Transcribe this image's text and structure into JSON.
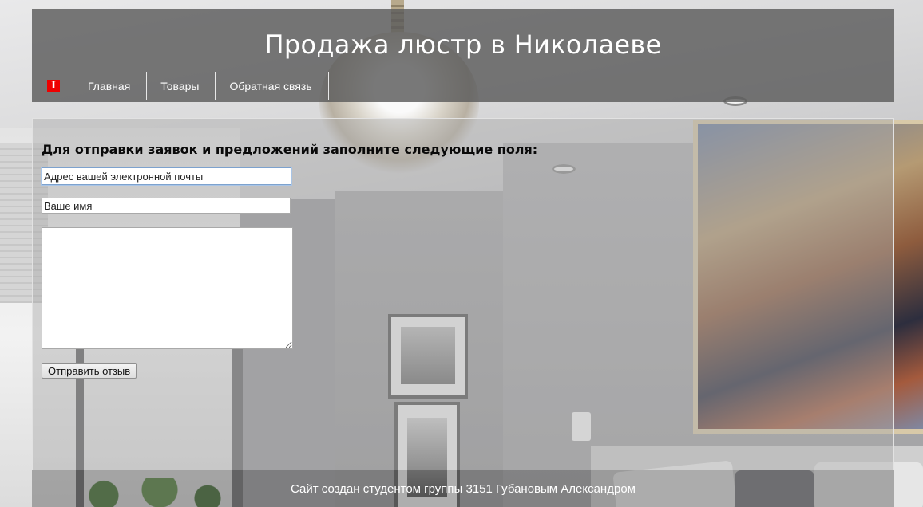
{
  "header": {
    "title": "Продажа люстр в Николаеве",
    "logo_glyph": "I",
    "nav": [
      {
        "label": "Главная"
      },
      {
        "label": "Товары"
      },
      {
        "label": "Обратная связь"
      }
    ]
  },
  "form": {
    "heading": "Для отправки заявок и предложений заполните следующие поля:",
    "email_value": "Адрес вашей электронной почты",
    "name_value": "Ваше имя",
    "message_value": "",
    "submit_label": "Отправить отзыв"
  },
  "footer": {
    "text": "Сайт создан студентом группы 3151 Губановым Александром"
  },
  "colors": {
    "logo_accent": "#ee0000",
    "header_bg": "#5c5c5c",
    "text_light": "#ffffff"
  }
}
